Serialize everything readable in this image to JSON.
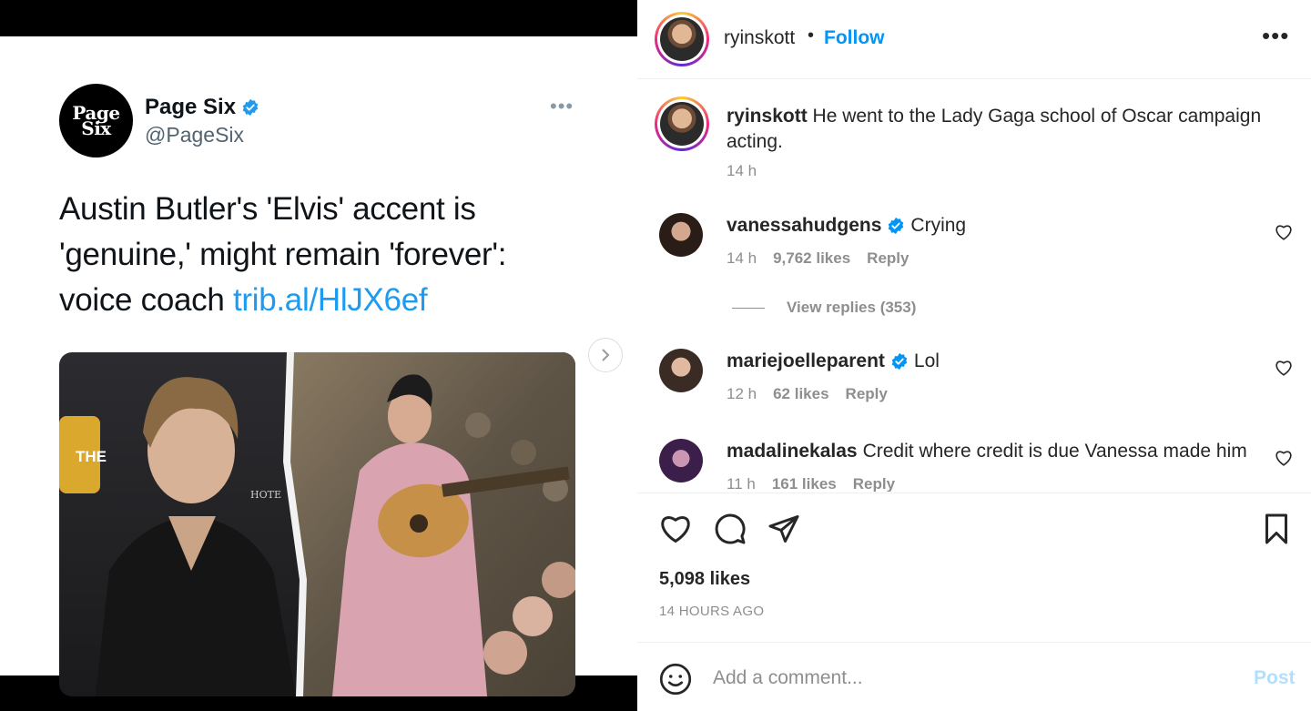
{
  "tweet": {
    "avatar_line1": "Page",
    "avatar_line2": "Six",
    "name": "Page Six",
    "handle": "@PageSix",
    "text": "Austin Butler's 'Elvis' accent is 'genuine,' might remain 'forever': voice coach ",
    "link": "trib.al/HlJX6ef",
    "image_sign_text": "THE",
    "image_sign_text2": "HOTE"
  },
  "post": {
    "username": "ryinskott",
    "separator": "•",
    "follow_label": "Follow",
    "caption_username": "ryinskott",
    "caption": "He went to the Lady Gaga school of Oscar campaign acting.",
    "caption_time": "14 h",
    "likes": "5,098 likes",
    "time_ago": "14 HOURS AGO"
  },
  "comments": [
    {
      "username": "vanessahudgens",
      "verified": true,
      "text": "Crying",
      "time": "14 h",
      "likes": "9,762 likes",
      "reply": "Reply"
    },
    {
      "username": "mariejoelleparent",
      "verified": true,
      "text": "Lol",
      "time": "12 h",
      "likes": "62 likes",
      "reply": "Reply"
    },
    {
      "username": "madalinekalas",
      "verified": false,
      "text": "Credit where credit is due Vanessa made him",
      "time": "11 h",
      "likes": "161 likes",
      "reply": "Reply"
    }
  ],
  "view_replies": "View replies (353)",
  "add_comment": {
    "placeholder": "Add a comment...",
    "post_label": "Post"
  },
  "colors": {
    "link": "#0095f6",
    "verified": "#0095f6",
    "tweet_link": "#1d9bf0",
    "post_disabled": "#b2dffc"
  },
  "icons": [
    "more-icon",
    "heart-icon",
    "comment-icon",
    "share-icon",
    "bookmark-icon",
    "emoji-icon",
    "verified-icon",
    "chevron-right-icon"
  ]
}
